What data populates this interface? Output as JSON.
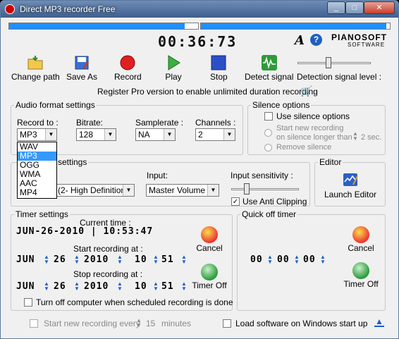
{
  "window": {
    "title": "Direct MP3 recorder Free",
    "min": "_",
    "max": "□",
    "close": "✕"
  },
  "meters": {
    "left_level": 0.93,
    "right_level": 0.98
  },
  "time_display": "00:36:73",
  "brand": {
    "a": "A",
    "help": "?",
    "name": "PIANOSOFT",
    "sub": "SOFTWARE"
  },
  "toolbar": {
    "change_path": "Change path",
    "save_as": "Save As",
    "record": "Record",
    "play": "Play",
    "stop": "Stop",
    "detect": "Detect signal",
    "detect_level_label": "Detection signal level :",
    "detect_level": 0.42
  },
  "register_text": "Register Pro version to enable unlimited duration recording",
  "audio_format": {
    "legend": "Audio format settings",
    "record_to_label": "Record to :",
    "record_to_value": "MP3",
    "bitrate_label": "Bitrate:",
    "bitrate_value": "128",
    "samplerate_label": "Samplerate :",
    "samplerate_value": "NA",
    "channels_label": "Channels :",
    "channels_value": "2",
    "options": [
      "WAV",
      "MP3",
      "OGG",
      "WMA",
      "AAC",
      "MP4"
    ]
  },
  "silence": {
    "legend": "Silence options",
    "use_label": "Use silence options",
    "start_label_1": "Start new recording",
    "start_label_2": "on silence longer than",
    "seconds": "2 sec.",
    "remove_label": "Remove silence"
  },
  "input_settings": {
    "legend": "settings",
    "device_value": "e (2- High Definition",
    "input_label": "Input:",
    "input_value": "Master Volume",
    "sensitivity_label": "Input sensitivity :",
    "sensitivity": 0.2,
    "anticlip_label": "Use Anti Clipping"
  },
  "editor": {
    "legend": "Editor",
    "launch_label": "Launch Editor"
  },
  "timer": {
    "legend": "Timer settings",
    "current_label": "Current time :",
    "current_value": "JUN-26-2010  |  10:53:47",
    "start_label": "Start recording at :",
    "start_month": "JUN",
    "start_day": "26",
    "start_year": "2010",
    "start_hour": "10",
    "start_min": "51",
    "stop_label": "Stop recording at :",
    "stop_month": "JUN",
    "stop_day": "26",
    "stop_year": "2010",
    "stop_hour": "10",
    "stop_min": "51",
    "cancel": "Cancel",
    "timer_off": "Timer Off",
    "turnoff_label": "Turn off computer when scheduled recording is done"
  },
  "quickoff": {
    "legend": "Quick off timer",
    "h": "00",
    "m": "00",
    "s": "00",
    "cancel": "Cancel",
    "timer_off": "Timer Off"
  },
  "footer": {
    "start_every_label": "Start new recording every",
    "minutes_value": "15",
    "minutes_label": "minutes",
    "load_label": "Load software on Windows start up"
  }
}
